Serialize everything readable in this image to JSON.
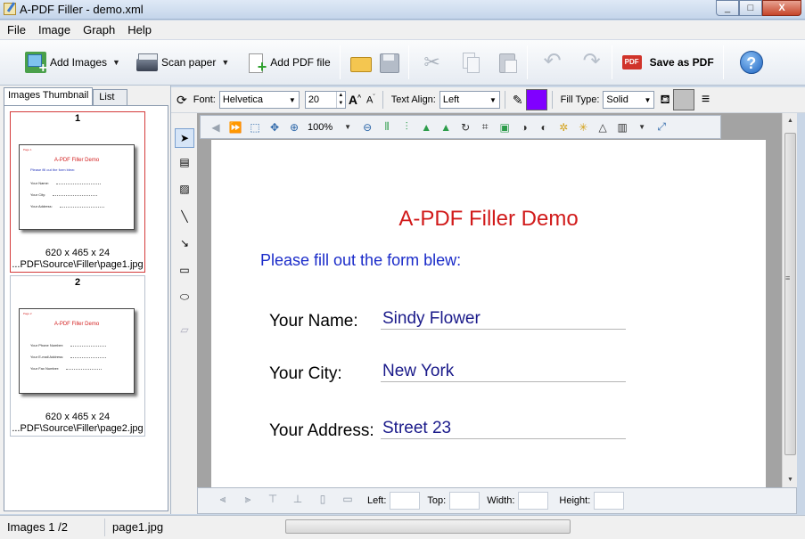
{
  "window": {
    "title": "A-PDF Filler - demo.xml",
    "min": "_",
    "max": "□",
    "close": "X"
  },
  "menu": [
    "File",
    "Image",
    "Graph",
    "Help"
  ],
  "toolbar": {
    "add_images": "Add Images",
    "scan_paper": "Scan paper",
    "add_pdf": "Add PDF file",
    "save_pdf": "Save as PDF"
  },
  "left_tabs": [
    "Images Thumbnail",
    "List"
  ],
  "thumbnails": [
    {
      "num": "1",
      "size": "620 x 465 x 24",
      "path": "...PDF\\Source\\Filler\\page1.jpg",
      "page_title": "A-PDF Filler Demo",
      "page_sub": "Please fill out the form blew:",
      "page_lines": [
        "Your Name:",
        "Your City:",
        "Your Address:"
      ]
    },
    {
      "num": "2",
      "size": "620 x 465 x 24",
      "path": "...PDF\\Source\\Filler\\page2.jpg",
      "page_title": "A-PDF Filler Demo",
      "page_sub": "",
      "page_lines": [
        "Your Phone Number:",
        "Your E-mail Address:",
        "Your Fax Number:"
      ]
    }
  ],
  "format": {
    "font_label": "Font:",
    "font": "Helvetica",
    "size": "20",
    "text_align_label": "Text Align:",
    "text_align": "Left",
    "fill_type_label": "Fill Type:",
    "fill_type": "Solid",
    "text_color": "#8000ff",
    "fill_color": "#c0c0c0"
  },
  "view": {
    "zoom": "100%"
  },
  "document": {
    "title": "A-PDF Filler Demo",
    "subtitle": "Please fill out the form blew:",
    "fields": [
      {
        "label": "Your Name:",
        "value": "Sindy Flower"
      },
      {
        "label": "Your City:",
        "value": "New York"
      },
      {
        "label": "Your Address:",
        "value": "Street 23"
      }
    ]
  },
  "align": {
    "left": "Left:",
    "top": "Top:",
    "width": "Width:",
    "height": "Height:"
  },
  "status": {
    "images": "Images 1 /2",
    "file": "page1.jpg"
  }
}
